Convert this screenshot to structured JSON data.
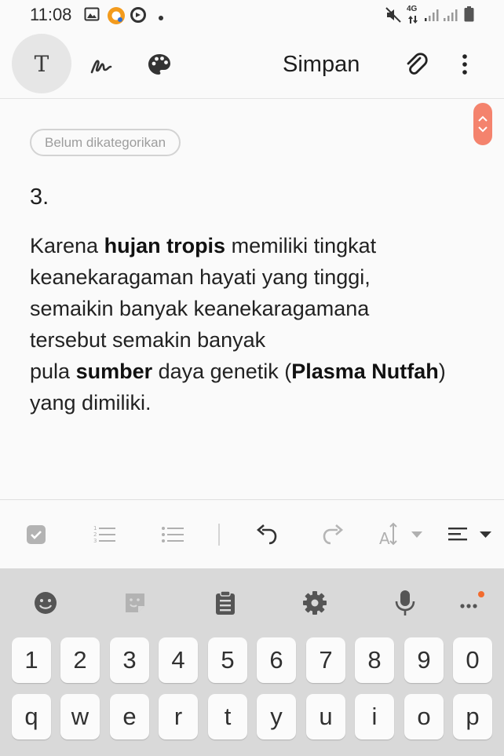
{
  "status_bar": {
    "time": "11:08",
    "network": "4G"
  },
  "toolbar": {
    "text_mode_label": "T",
    "save_label": "Simpan"
  },
  "note": {
    "category": "Belum dikategorikan",
    "number": "3.",
    "body": {
      "l1_a": "Karena ",
      "l1_b": "hujan tropis",
      "l1_c": " memiliki tingkat",
      "l2": "keanekaragaman hayati yang tinggi,",
      "l3": "semaikin banyak keanekaragamana",
      "l4": "tersebut semakin banyak",
      "l5_a": "pula ",
      "l5_b": "sumber",
      "l5_c": " daya genetik (",
      "l5_d": "Plasma Nutfah",
      "l5_e": ")",
      "l6": "yang dimiliki."
    }
  },
  "keyboard": {
    "number_row": [
      "1",
      "2",
      "3",
      "4",
      "5",
      "6",
      "7",
      "8",
      "9",
      "0"
    ],
    "letter_row": [
      "q",
      "w",
      "e",
      "r",
      "t",
      "y",
      "u",
      "i",
      "o",
      "p"
    ]
  },
  "colors": {
    "accent": "#f4836d",
    "keyboard_bg": "#d9d9d9",
    "key_bg": "#fbfbfb"
  }
}
